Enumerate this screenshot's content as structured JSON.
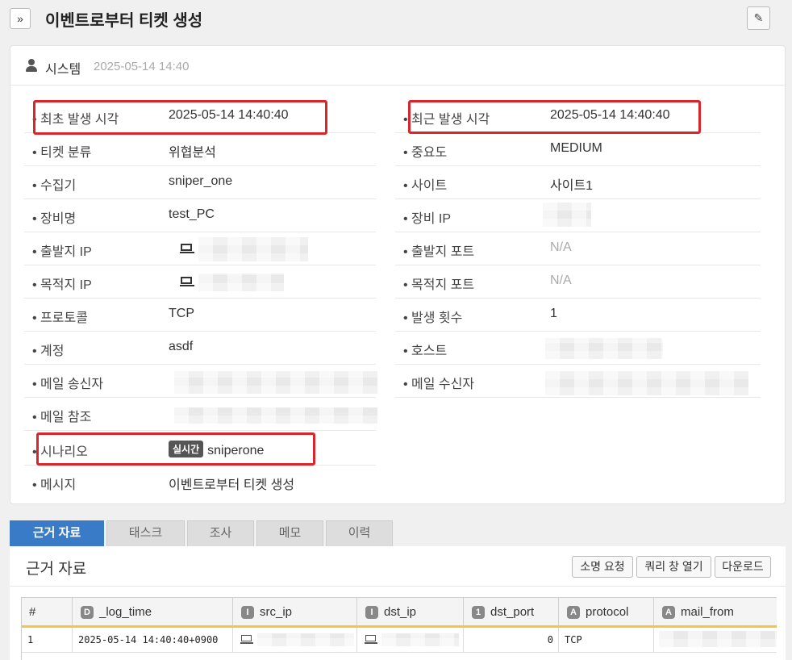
{
  "header": {
    "expand_icon": "»",
    "title": "이벤트로부터 티켓 생성",
    "edit_icon": "pencil-icon"
  },
  "card": {
    "user": "시스템",
    "time": "2025-05-14 14:40",
    "fields_left": [
      {
        "label": "• 최초 발생 시각",
        "value": "2025-05-14 14:40:40"
      },
      {
        "label": "• 티켓 분류",
        "value": "위협분석"
      },
      {
        "label": "• 수집기",
        "value": "sniper_one"
      },
      {
        "label": "• 장비명",
        "value": "test_PC"
      },
      {
        "label": "• 출발지 IP",
        "value": ""
      },
      {
        "label": "• 목적지 IP",
        "value": ""
      },
      {
        "label": "• 프로토콜",
        "value": "TCP"
      },
      {
        "label": "• 계정",
        "value": "asdf"
      },
      {
        "label": "• 메일 송신자",
        "value": ""
      },
      {
        "label": "• 메일 참조",
        "value": ""
      },
      {
        "label": "• 시나리오",
        "badge": "실시간",
        "value": "sniperone"
      },
      {
        "label": "• 메시지",
        "value": "이벤트로부터 티켓 생성"
      }
    ],
    "fields_right": [
      {
        "label": "• 최근 발생 시각",
        "value": "2025-05-14 14:40:40"
      },
      {
        "label": "• 중요도",
        "value": "MEDIUM"
      },
      {
        "label": "• 사이트",
        "value": "사이트1"
      },
      {
        "label": "• 장비 IP",
        "value": ""
      },
      {
        "label": "• 출발지 포트",
        "value": "N/A"
      },
      {
        "label": "• 목적지 포트",
        "value": "N/A"
      },
      {
        "label": "• 발생 횟수",
        "value": "1"
      },
      {
        "label": "• 호스트",
        "value": ""
      },
      {
        "label": "• 메일 수신자",
        "value": ""
      }
    ]
  },
  "tabs": [
    "근거 자료",
    "태스크",
    "조사",
    "메모",
    "이력"
  ],
  "panel": {
    "title": "근거 자료",
    "buttons": [
      "소명 요청",
      "쿼리 창 열기",
      "다운로드"
    ]
  },
  "grid": {
    "columns": [
      {
        "type": "",
        "name": "#"
      },
      {
        "type": "D",
        "name": "_log_time"
      },
      {
        "type": "I",
        "name": "src_ip"
      },
      {
        "type": "I",
        "name": "dst_ip"
      },
      {
        "type": "1",
        "name": "dst_port"
      },
      {
        "type": "A",
        "name": "protocol"
      },
      {
        "type": "A",
        "name": "mail_from"
      }
    ],
    "rows": [
      [
        "1",
        "2025-05-14 14:40:40+0900",
        "",
        "",
        "0",
        "TCP",
        ""
      ]
    ]
  },
  "colors": {
    "accent": "#3a7bc8",
    "highlight": "#d9262b",
    "grid_underline": "#f5c441"
  }
}
